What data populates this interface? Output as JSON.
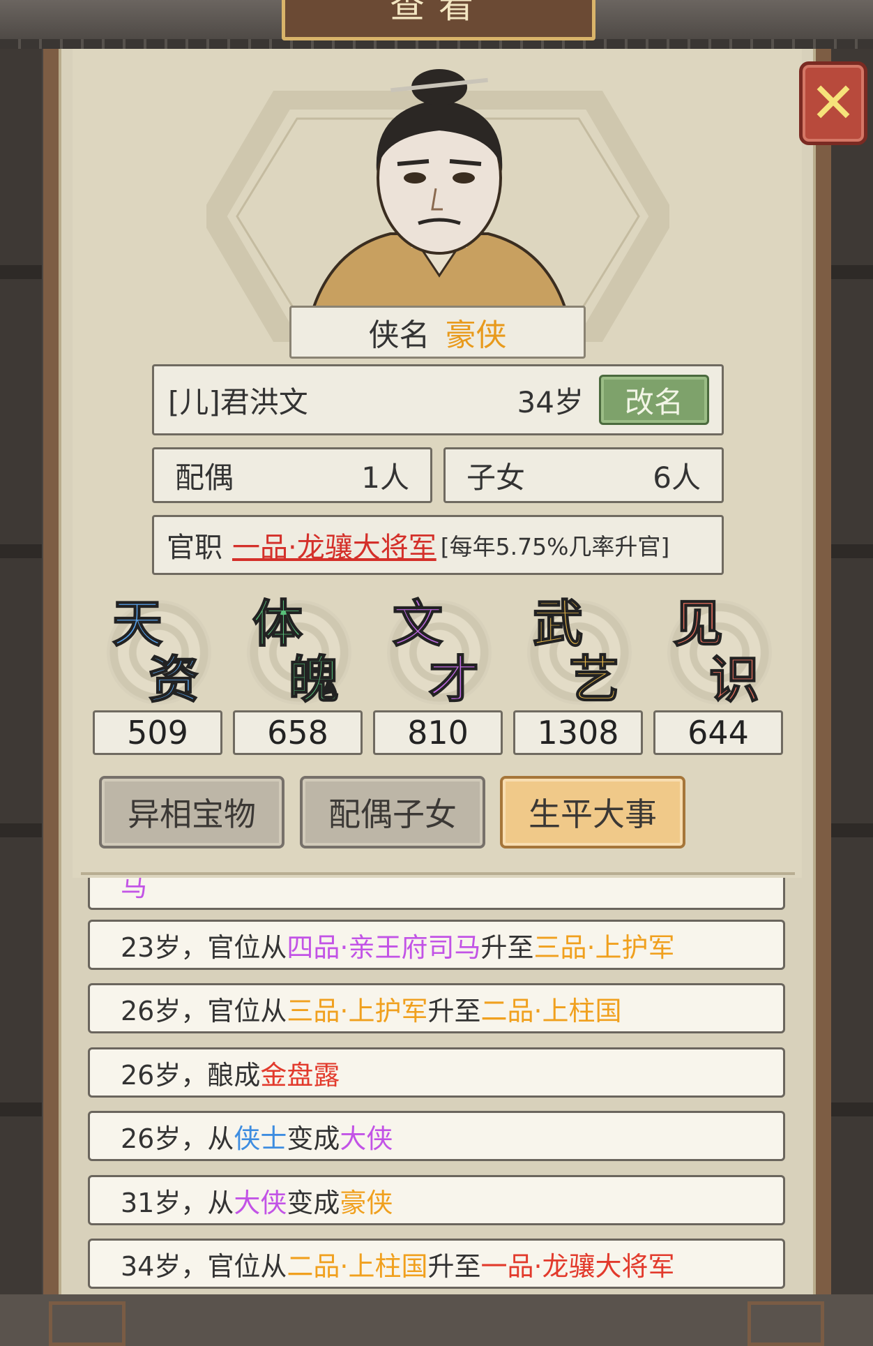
{
  "window": {
    "title": "查看"
  },
  "profile": {
    "title_label": "侠名",
    "title_value": "豪侠",
    "name": "[儿]君洪文",
    "age": "34岁",
    "rename_label": "改名",
    "spouse_label": "配偶",
    "spouse_count": "1人",
    "children_label": "子女",
    "children_count": "6人",
    "office_label": "官职",
    "office_rank": "一品·龙骧大将军",
    "office_prob": "[每年5.75%几率升官]"
  },
  "stats": [
    {
      "c1": "天",
      "c2": "资",
      "value": "509",
      "color": "#5aa6f0"
    },
    {
      "c1": "体",
      "c2": "魄",
      "value": "658",
      "color": "#58c07a"
    },
    {
      "c1": "文",
      "c2": "才",
      "value": "810",
      "color": "#c46be8"
    },
    {
      "c1": "武",
      "c2": "艺",
      "value": "1308",
      "color": "#e8b84a"
    },
    {
      "c1": "见",
      "c2": "识",
      "value": "644",
      "color": "#e8705e"
    }
  ],
  "tabs": {
    "treasure": "异相宝物",
    "family": "配偶子女",
    "events": "生平大事"
  },
  "close_icon": "close-icon",
  "log": {
    "partial_top": "马",
    "items": [
      [
        {
          "t": "23岁，官位从"
        },
        {
          "t": "四品·亲王府司马",
          "c": "purple"
        },
        {
          "t": "升至"
        },
        {
          "t": "三品·上护军",
          "c": "orange"
        }
      ],
      [
        {
          "t": "26岁，官位从"
        },
        {
          "t": "三品·上护军",
          "c": "orange"
        },
        {
          "t": "升至"
        },
        {
          "t": "二品·上柱国",
          "c": "orange"
        }
      ],
      [
        {
          "t": "26岁，酿成"
        },
        {
          "t": "金盘露",
          "c": "red"
        }
      ],
      [
        {
          "t": "26岁，从"
        },
        {
          "t": "侠士",
          "c": "blue"
        },
        {
          "t": "变成"
        },
        {
          "t": "大侠",
          "c": "purple"
        }
      ],
      [
        {
          "t": "31岁，从"
        },
        {
          "t": "大侠",
          "c": "purple"
        },
        {
          "t": "变成"
        },
        {
          "t": "豪侠",
          "c": "orange"
        }
      ],
      [
        {
          "t": "34岁，官位从"
        },
        {
          "t": "二品·上柱国",
          "c": "orange"
        },
        {
          "t": "升至"
        },
        {
          "t": "一品·龙骧大将军",
          "c": "red"
        }
      ]
    ]
  }
}
